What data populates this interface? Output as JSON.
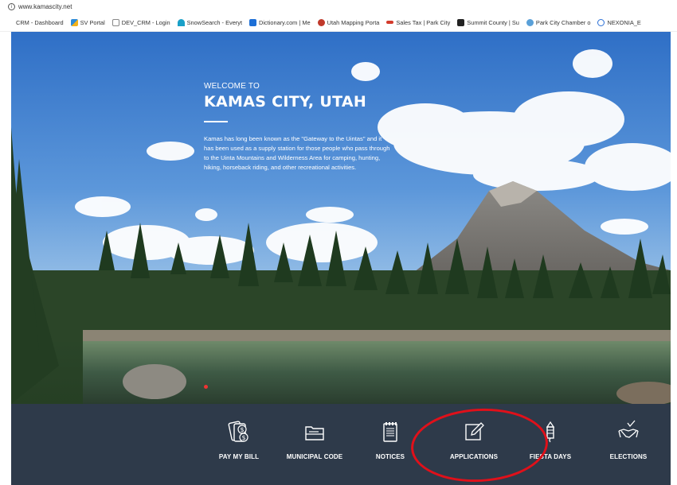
{
  "browser": {
    "url": "www.kamascity.net",
    "bookmarks": [
      {
        "label": "CRM - Dashboard",
        "icon": "none",
        "color": "#ffffff"
      },
      {
        "label": "SV Portal",
        "icon": "triangle-icon",
        "color": "#2e8bd8"
      },
      {
        "label": "DEV_CRM - Login",
        "icon": "page-icon",
        "color": "#888888"
      },
      {
        "label": "SnowSearch - Everyt",
        "icon": "snow-icon",
        "color": "#1aa0c8"
      },
      {
        "label": "Dictionary.com | Me",
        "icon": "dictionary-icon",
        "color": "#1d6fd6"
      },
      {
        "label": "Utah Mapping Porta",
        "icon": "map-icon",
        "color": "#c0392b"
      },
      {
        "label": "Sales Tax | Park City",
        "icon": "tax-icon",
        "color": "#d33b2c"
      },
      {
        "label": "Summit County | Su",
        "icon": "county-icon",
        "color": "#222222"
      },
      {
        "label": "Park City Chamber o",
        "icon": "chamber-icon",
        "color": "#5aa0d8"
      },
      {
        "label": "NEXONIA_E",
        "icon": "x-icon",
        "color": "#2a6fd6"
      }
    ]
  },
  "hero": {
    "welcome": "WELCOME TO",
    "title": "KAMAS CITY, UTAH",
    "description": "Kamas has long been known as the \"Gateway to the Uintas\" and it has been used as a supply station for those people who pass through to the Uinta Mountains and Wilderness Area for camping, hunting, hiking, horseback riding, and other recreational activities."
  },
  "nav": [
    {
      "label": "PAY MY BILL",
      "icon": "bill-icon"
    },
    {
      "label": "MUNICIPAL CODE",
      "icon": "folder-icon"
    },
    {
      "label": "NOTICES",
      "icon": "notepad-icon"
    },
    {
      "label": "APPLICATIONS",
      "icon": "edit-icon"
    },
    {
      "label": "FIESTA DAYS",
      "icon": "firework-icon"
    },
    {
      "label": "ELECTIONS",
      "icon": "handshake-icon"
    }
  ],
  "colors": {
    "navbar": "#2e3a4a",
    "annotation_circle": "#e0101a"
  }
}
